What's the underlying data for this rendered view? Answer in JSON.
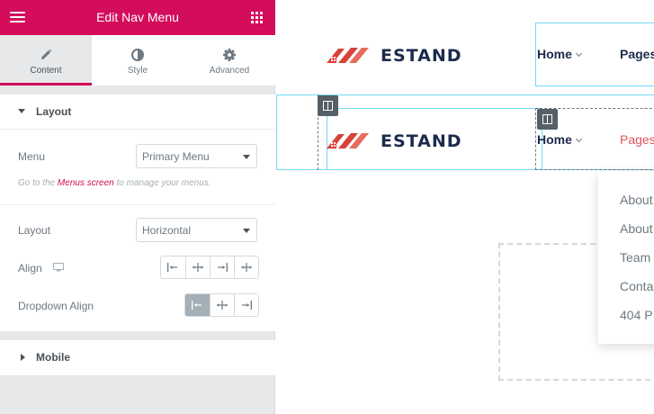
{
  "panel": {
    "title": "Edit Nav Menu",
    "tabs": [
      {
        "label": "Content",
        "icon": "pencil-icon",
        "active": true
      },
      {
        "label": "Style",
        "icon": "half-circle-icon",
        "active": false
      },
      {
        "label": "Advanced",
        "icon": "gear-icon",
        "active": false
      }
    ],
    "layout_section": {
      "title": "Layout",
      "menu_label": "Menu",
      "menu_value": "Primary Menu",
      "hint_before": "Go to the ",
      "hint_link": "Menus screen",
      "hint_after": " to manage your menus.",
      "layout_label": "Layout",
      "layout_value": "Horizontal",
      "align_label": "Align",
      "dropdown_align_label": "Dropdown Align"
    },
    "mobile_section": {
      "title": "Mobile"
    },
    "colors": {
      "accent": "#d30c5c",
      "selected_button": "#a4afb7"
    }
  },
  "canvas": {
    "brand": "ESTAND",
    "nav_top": [
      {
        "label": "Home",
        "has_dropdown": true
      },
      {
        "label": "Pages",
        "has_dropdown": false
      }
    ],
    "nav_bottom": [
      {
        "label": "Home",
        "has_dropdown": true
      },
      {
        "label": "Pages",
        "has_dropdown": false
      }
    ],
    "dropdown_items": [
      "About",
      "About",
      "Team",
      "Conta",
      "404 P"
    ],
    "colors": {
      "brand_text": "#1c2b4c",
      "roof": "#d9413a",
      "active_link": "#e0565a",
      "outline": "#71d7f7"
    }
  }
}
